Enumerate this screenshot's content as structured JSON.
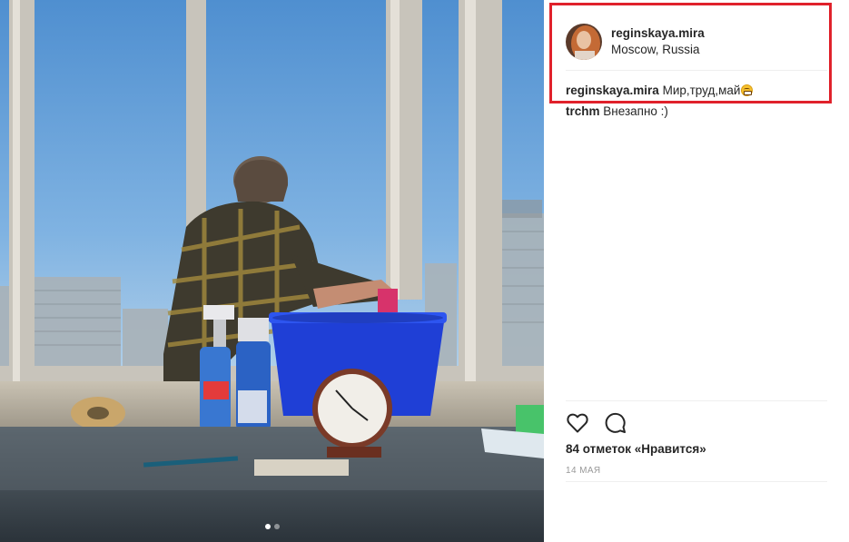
{
  "post": {
    "author": "reginskaya.mira",
    "location": "Moscow, Russia",
    "comments": [
      {
        "author": "reginskaya.mira",
        "text": "Мир,труд,май",
        "emoji": "grinning-squint-face"
      },
      {
        "author": "trchm",
        "text": "Внезапно :)"
      }
    ],
    "likes_text": "84 отметок «Нравится»",
    "timestamp": "14 мая",
    "carousel": {
      "total": 2,
      "active": 1
    }
  },
  "icons": {
    "like": "heart-outline-icon",
    "comment": "speech-bubble-icon"
  },
  "colors": {
    "highlight": "#e0212b",
    "text": "#262626",
    "muted": "#999999"
  }
}
